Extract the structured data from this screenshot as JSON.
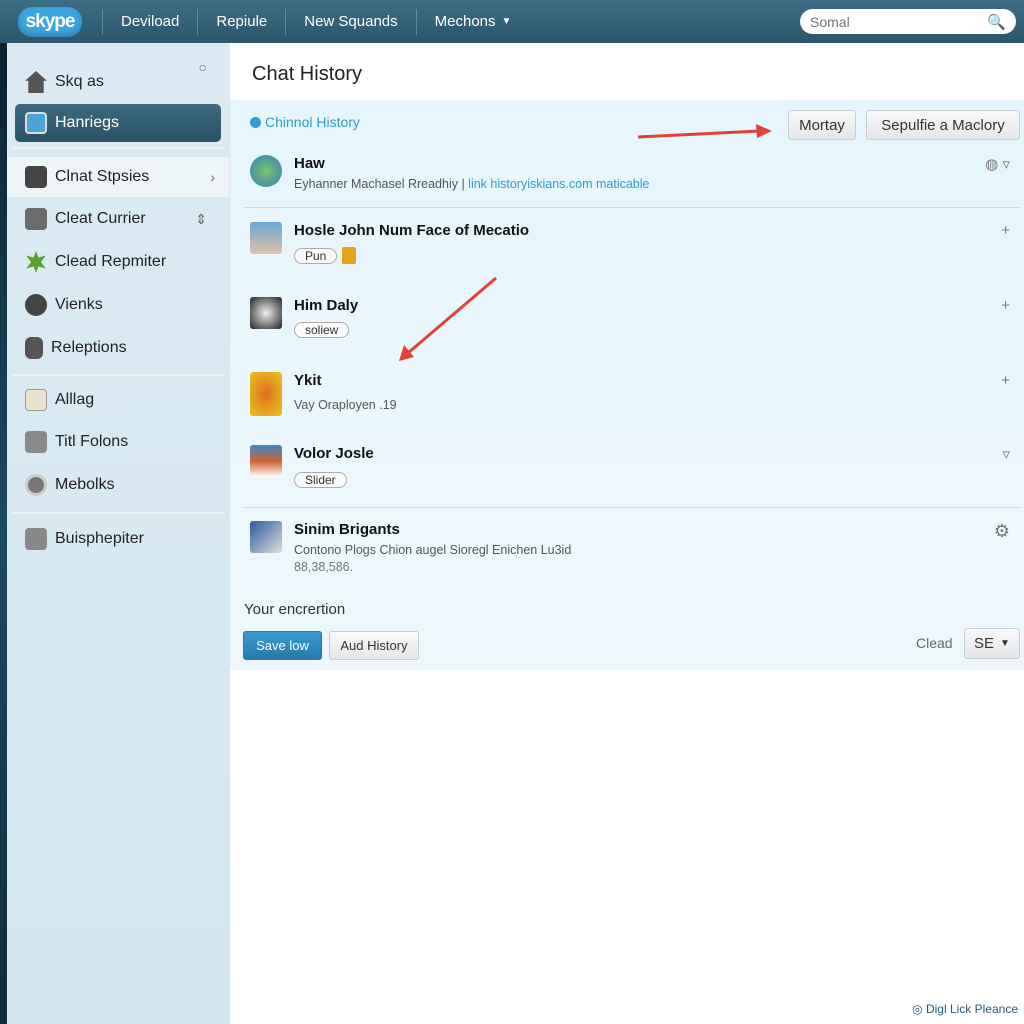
{
  "topbar": {
    "logo": "skype",
    "nav": [
      "Deviload",
      "Repiule",
      "New Squands",
      "Mechons"
    ],
    "search_placeholder": "Somal"
  },
  "sidebar": {
    "items": [
      {
        "label": "Skq as",
        "icon": "house-icon",
        "trail": "○"
      },
      {
        "label": "Hanriegs",
        "icon": "computer-icon",
        "active": true
      },
      {
        "label": "Clnat Stpsies",
        "icon": "keyboard-icon",
        "trail": "›"
      },
      {
        "label": "Cleat Currier",
        "icon": "camera-icon",
        "trail": "⇕"
      },
      {
        "label": "Clead Repmiter",
        "icon": "star-icon"
      },
      {
        "label": "Vienks",
        "icon": "globe-icon"
      },
      {
        "label": "Releptions",
        "icon": "trash-icon"
      },
      {
        "label": "Alllag",
        "icon": "document-icon"
      },
      {
        "label": "Titl Folons",
        "icon": "folder-icon"
      },
      {
        "label": "Mebolks",
        "icon": "clock-icon"
      },
      {
        "label": "Buisphepiter",
        "icon": "disk-icon"
      }
    ]
  },
  "main": {
    "title": "Chat History",
    "breadcrumb": "Chinnol History",
    "buttons": {
      "mortay": "Mortay",
      "sepulfie": "Sepulfie a Maclory"
    },
    "rows": [
      {
        "name": "Haw",
        "sub": "Eyhanner Machasel Rreadhiy | ",
        "link": "link historyiskians.com maticable",
        "action": "◍ ▿"
      },
      {
        "name": "Hosle John Num Face of Mecatio",
        "pill": "Pun",
        "action": "+"
      },
      {
        "name": "Him Daly",
        "pill": "soliew",
        "action": "+"
      },
      {
        "name": "Ykit",
        "sub": "Vay Oraployen .19",
        "action": "+"
      },
      {
        "name": "Volor Josle",
        "pill": "Slider",
        "action": "▿"
      },
      {
        "name": "Sinim Brigants",
        "sub": "Contono Plogs Chion augel Sioregl Enichen Lu3id",
        "sub2": "88,38,586.",
        "action": "⚙"
      }
    ],
    "section_label": "Your encrertion",
    "save_button": "Save low",
    "add_button": "Aud History",
    "clear": "Clead",
    "select": "SE"
  },
  "footer": "Digl Lick Pleance",
  "colors": {
    "accent": "#2f9bd0",
    "topbar": "#2b566b",
    "arrow": "#e0413a"
  }
}
